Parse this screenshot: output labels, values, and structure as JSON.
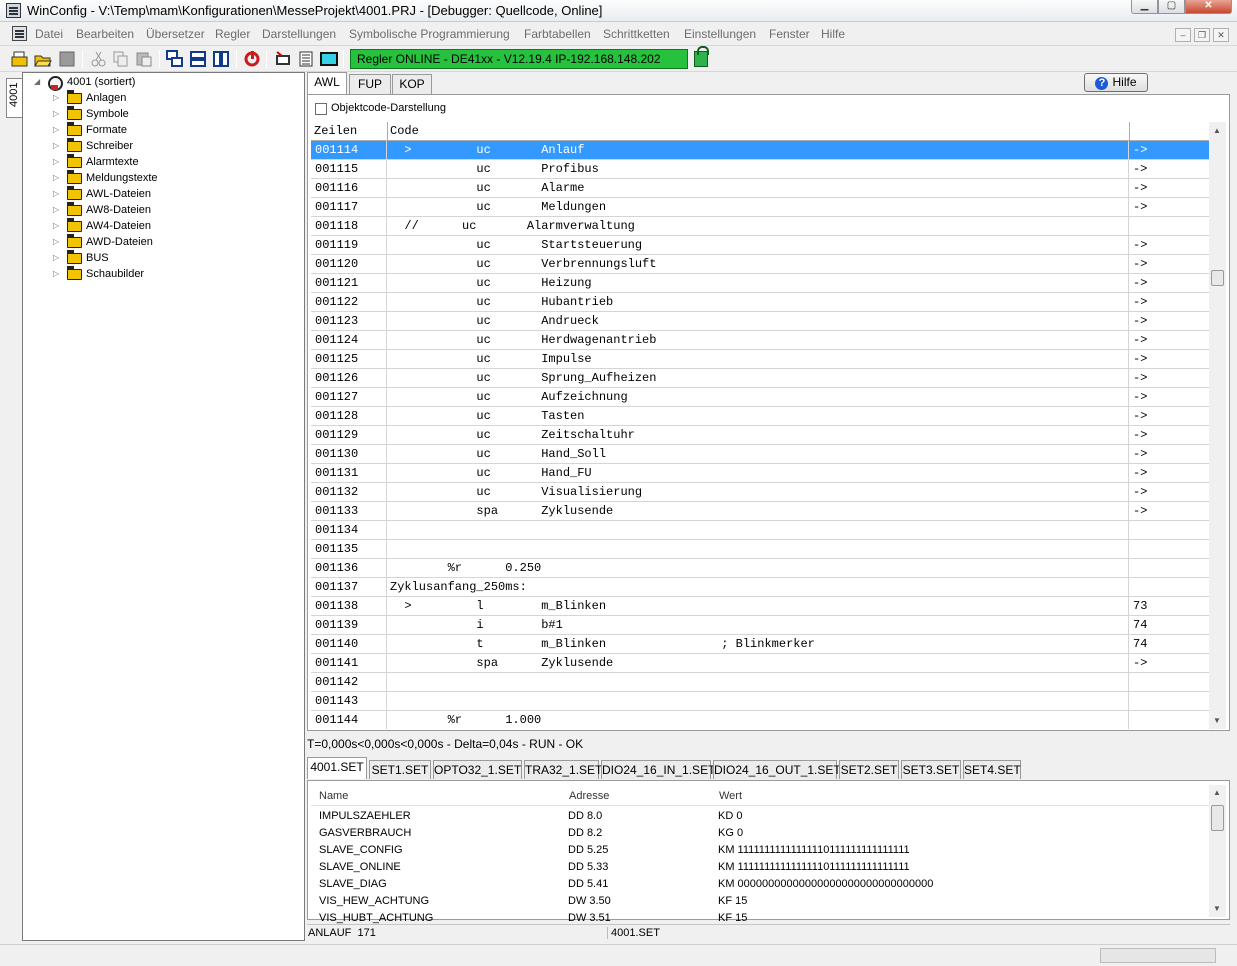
{
  "window": {
    "title": "WinConfig - V:\\Temp\\mam\\Konfigurationen\\MesseProjekt\\4001.PRJ - [Debugger: Quellcode, Online]"
  },
  "menu": {
    "items": [
      "Datei",
      "Bearbeiten",
      "Übersetzer",
      "Regler",
      "Darstellungen",
      "Symbolische Programmierung",
      "Farbtabellen",
      "Schrittketten",
      "Einstellungen",
      "Fenster",
      "Hilfe"
    ]
  },
  "toolbar": {
    "status_text": "Regler ONLINE  - DE41xx - V12.19.4  IP-192.168.148.202",
    "status_color": "#27c23d"
  },
  "sidebar": {
    "tab_label": "4001",
    "root": "4001 (sortiert)",
    "items": [
      "Anlagen",
      "Symbole",
      "Formate",
      "Schreiber",
      "Alarmtexte",
      "Meldungstexte",
      "AWL-Dateien",
      "AW8-Dateien",
      "AW4-Dateien",
      "AWD-Dateien",
      "BUS",
      "Schaubilder"
    ]
  },
  "editor": {
    "tabs": [
      "AWL",
      "FUP",
      "KOP"
    ],
    "help_label": "Hilfe",
    "objcode_label": "Objektcode-Darstellung",
    "col_lines": "Zeilen",
    "col_code": "Code",
    "selected_color": "#3399ff",
    "rows": [
      {
        "line": "001114",
        "code": "  >         uc       Anlauf",
        "tail": "->"
      },
      {
        "line": "001115",
        "code": "            uc       Profibus",
        "tail": "->"
      },
      {
        "line": "001116",
        "code": "            uc       Alarme",
        "tail": "->"
      },
      {
        "line": "001117",
        "code": "            uc       Meldungen",
        "tail": "->"
      },
      {
        "line": "001118",
        "code": "  //      uc       Alarmverwaltung",
        "tail": ""
      },
      {
        "line": "001119",
        "code": "            uc       Startsteuerung",
        "tail": "->"
      },
      {
        "line": "001120",
        "code": "            uc       Verbrennungsluft",
        "tail": "->"
      },
      {
        "line": "001121",
        "code": "            uc       Heizung",
        "tail": "->"
      },
      {
        "line": "001122",
        "code": "            uc       Hubantrieb",
        "tail": "->"
      },
      {
        "line": "001123",
        "code": "            uc       Andrueck",
        "tail": "->"
      },
      {
        "line": "001124",
        "code": "            uc       Herdwagenantrieb",
        "tail": "->"
      },
      {
        "line": "001125",
        "code": "            uc       Impulse",
        "tail": "->"
      },
      {
        "line": "001126",
        "code": "            uc       Sprung_Aufheizen",
        "tail": "->"
      },
      {
        "line": "001127",
        "code": "            uc       Aufzeichnung",
        "tail": "->"
      },
      {
        "line": "001128",
        "code": "            uc       Tasten",
        "tail": "->"
      },
      {
        "line": "001129",
        "code": "            uc       Zeitschaltuhr",
        "tail": "->"
      },
      {
        "line": "001130",
        "code": "            uc       Hand_Soll",
        "tail": "->"
      },
      {
        "line": "001131",
        "code": "            uc       Hand_FU",
        "tail": "->"
      },
      {
        "line": "001132",
        "code": "            uc       Visualisierung",
        "tail": "->"
      },
      {
        "line": "001133",
        "code": "            spa      Zyklusende",
        "tail": "->"
      },
      {
        "line": "001134",
        "code": "",
        "tail": ""
      },
      {
        "line": "001135",
        "code": "",
        "tail": ""
      },
      {
        "line": "001136",
        "code": "        %r      0.250",
        "tail": ""
      },
      {
        "line": "001137",
        "code": "Zyklusanfang_250ms:",
        "tail": ""
      },
      {
        "line": "001138",
        "code": "  >         l        m_Blinken",
        "tail": "73"
      },
      {
        "line": "001139",
        "code": "            i        b#1",
        "tail": "74"
      },
      {
        "line": "001140",
        "code": "            t        m_Blinken                ; Blinkmerker",
        "tail": "74"
      },
      {
        "line": "001141",
        "code": "            spa      Zyklusende",
        "tail": "->"
      },
      {
        "line": "001142",
        "code": "",
        "tail": ""
      },
      {
        "line": "001143",
        "code": "",
        "tail": ""
      },
      {
        "line": "001144",
        "code": "        %r      1.000",
        "tail": ""
      }
    ]
  },
  "statusline": "T=0,000s<0,000s<0,000s - Delta=0,04s - RUN - OK",
  "settabs": [
    "4001.SET",
    "SET1.SET",
    "OPTO32_1.SET",
    "TRA32_1.SET",
    "DIO24_16_IN_1.SET",
    "DIO24_16_OUT_1.SET",
    "SET2.SET",
    "SET3.SET",
    "SET4.SET"
  ],
  "settable": {
    "headers": [
      "Name",
      "Adresse",
      "Wert"
    ],
    "rows": [
      [
        "IMPULSZAEHLER",
        "DD 8.0",
        "KD 0"
      ],
      [
        "GASVERBRAUCH",
        "DD 8.2",
        "KG 0"
      ],
      [
        "SLAVE_CONFIG",
        "DD 5.25",
        "KM 11111111111111110111111111111111"
      ],
      [
        "SLAVE_ONLINE",
        "DD 5.33",
        "KM 11111111111111110111111111111111"
      ],
      [
        "SLAVE_DIAG",
        "DD 5.41",
        "KM 00000000000000000000000000000000"
      ],
      [
        "VIS_HEW_ACHTUNG",
        "DW 3.50",
        "KF 15"
      ],
      [
        "VIS_HUBT_ACHTUNG",
        "DW 3.51",
        "KF 15"
      ]
    ]
  },
  "bottom": {
    "left": "ANLAUF  171",
    "right": "4001.SET"
  }
}
